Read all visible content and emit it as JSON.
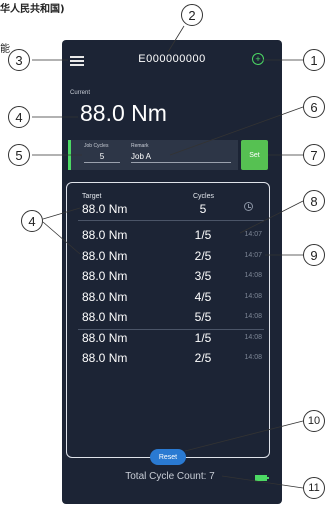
{
  "caption": {
    "line1": "华人民共和国)",
    "line2": "能"
  },
  "callouts": [
    "1",
    "2",
    "3",
    "4",
    "5",
    "6",
    "7",
    "8",
    "9",
    "10",
    "11"
  ],
  "header": {
    "device_id": "E000000000",
    "menu_icon": "hamburger-menu-icon",
    "status_icon": "connection-status-icon",
    "status_color": "#4cd964"
  },
  "current": {
    "label": "Current",
    "value": "88.0 Nm"
  },
  "job": {
    "cycles_label": "Job Cycles",
    "cycles_value": "5",
    "remark_label": "Remark",
    "remark_value": "Job A",
    "set_label": "Set"
  },
  "log": {
    "target_header": "Target",
    "cycles_header": "Cycles",
    "clock_icon": "clock-icon",
    "current_target": "88.0 Nm",
    "current_cycles": "5",
    "rows": [
      {
        "target": "88.0 Nm",
        "cycles": "1/5",
        "time": "14:07"
      },
      {
        "target": "88.0 Nm",
        "cycles": "2/5",
        "time": "14:07"
      },
      {
        "target": "88.0 Nm",
        "cycles": "3/5",
        "time": "14:08"
      },
      {
        "target": "88.0 Nm",
        "cycles": "4/5",
        "time": "14:08"
      },
      {
        "target": "88.0 Nm",
        "cycles": "5/5",
        "time": "14:08"
      },
      {
        "target": "88.0 Nm",
        "cycles": "1/5",
        "time": "14:08"
      },
      {
        "target": "88.0 Nm",
        "cycles": "2/5",
        "time": "14:08"
      }
    ]
  },
  "reset_label": "Reset",
  "total_count": "Total Cycle Count: 7",
  "battery_icon": "battery-icon",
  "colors": {
    "background": "#1c2435",
    "accent_green": "#56c152",
    "reset_blue": "#2a7ad2"
  }
}
